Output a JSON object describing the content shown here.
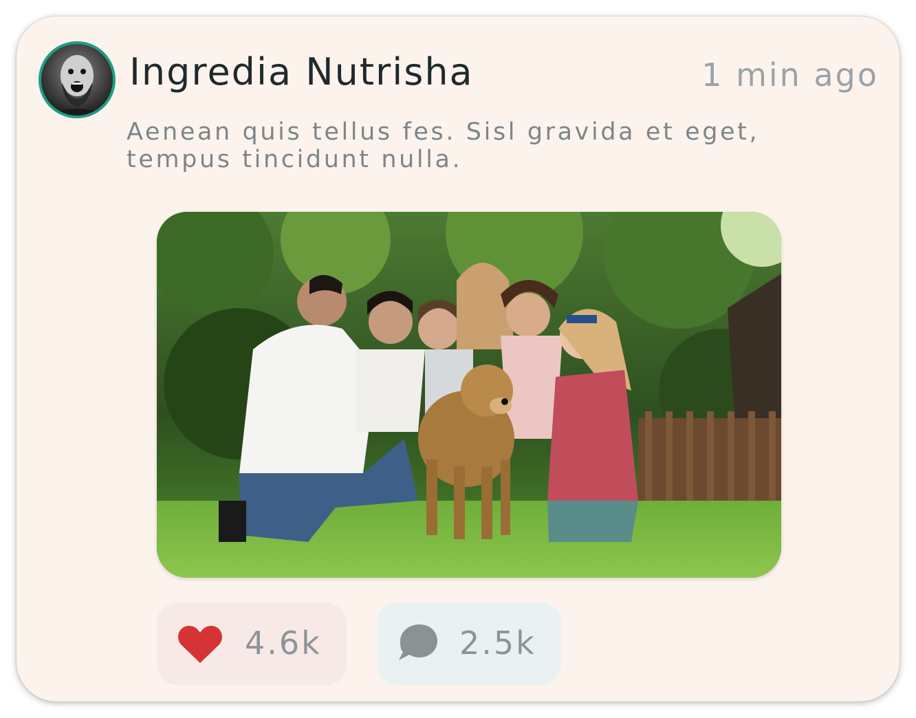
{
  "post": {
    "author": "Ingredia Nutrisha",
    "time": "1 min ago",
    "caption": "Aenean quis tellus fes. Sisl gravida et eget, tempus tincidunt nulla."
  },
  "reactions": {
    "likes": "4.6k",
    "comments": "2.5k"
  },
  "icons": {
    "like": "heart-icon",
    "comment": "comment-bubble-icon"
  },
  "colors": {
    "card_background": "#fcf4ec",
    "avatar_ring": "#1e9e86",
    "heart": "#d63334",
    "comment_icon": "#8c9194",
    "like_pill": "#f6e9e6",
    "comment_pill": "#eaf1f2"
  }
}
